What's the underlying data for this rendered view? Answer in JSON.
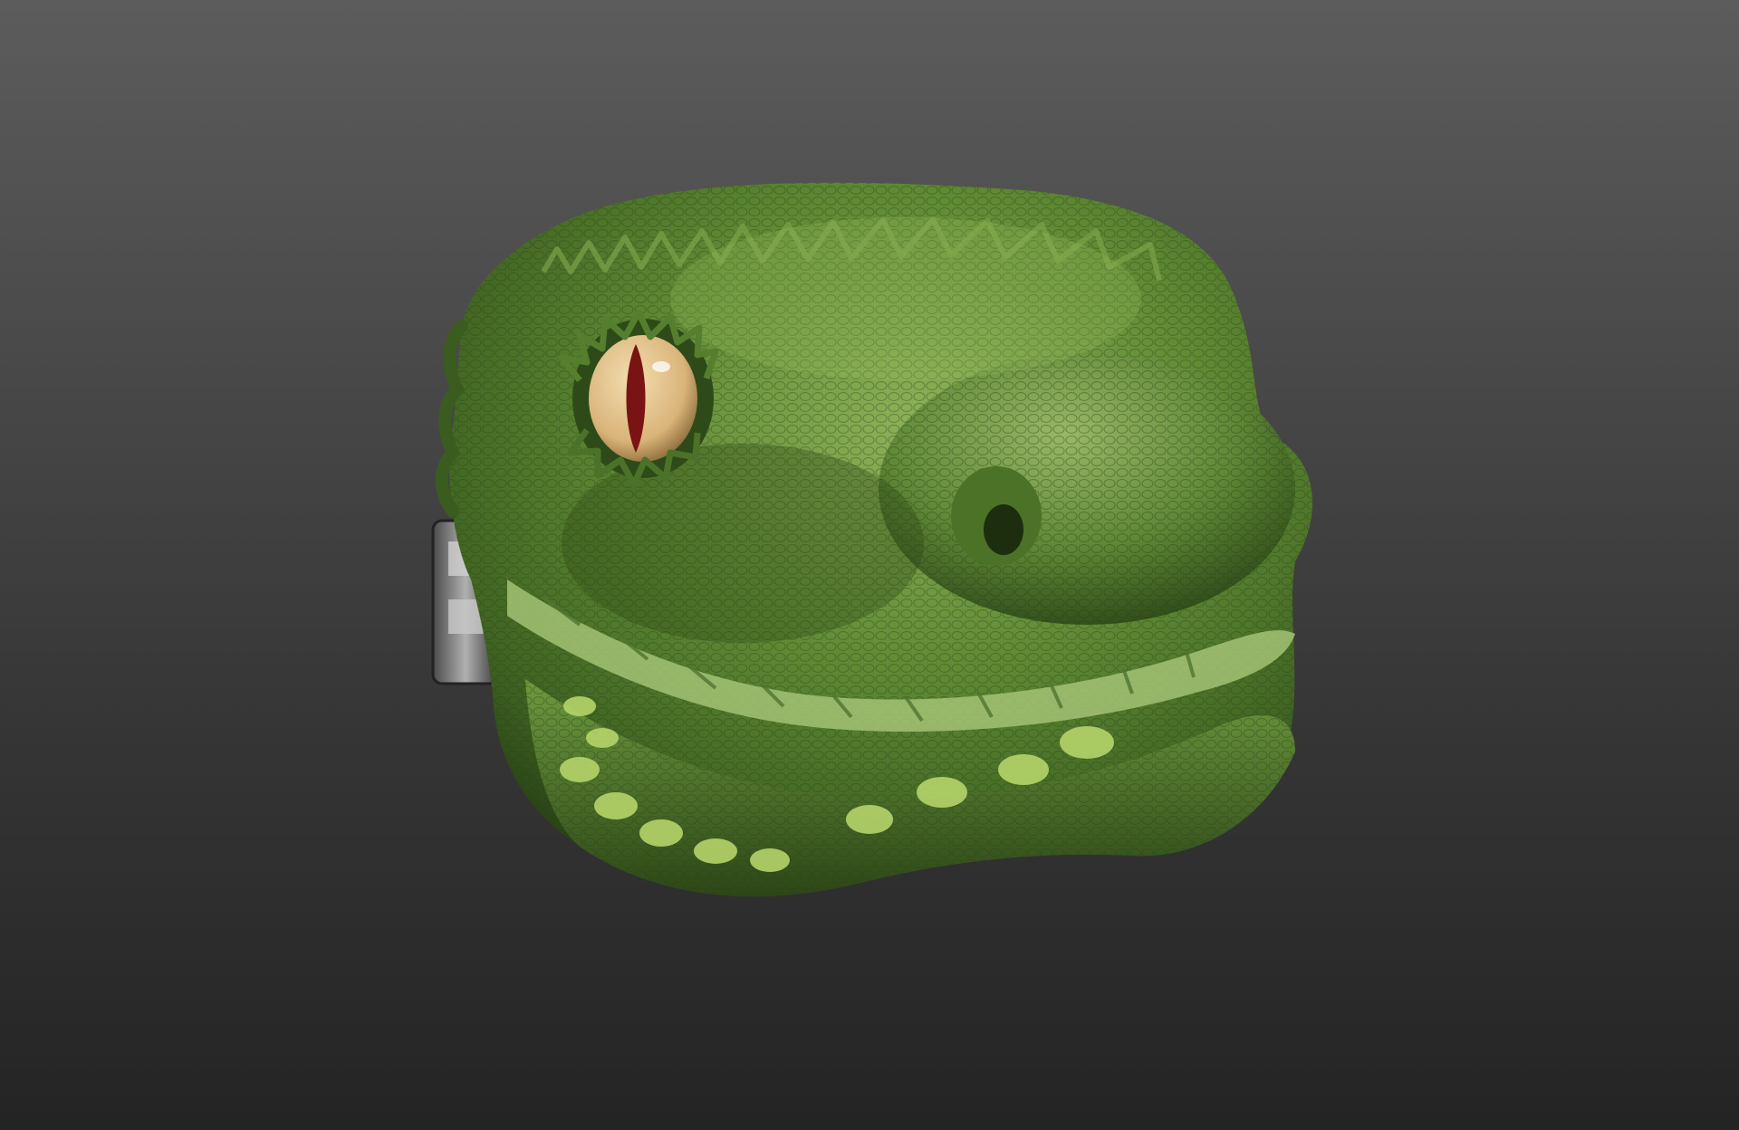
{
  "scene": {
    "background": {
      "top": "#5c5c5c",
      "bottom": "#242424"
    },
    "subject": "reptile-head-sculpt",
    "colors": {
      "skin_dark": "#2f4a1a",
      "skin_mid": "#4f7a2a",
      "skin_light": "#7fa84a",
      "scale_highlight": "#a8cc5e",
      "eye_iris": "#e6c793",
      "eye_pupil": "#7a1414",
      "metal": "#8a8a8a"
    }
  }
}
